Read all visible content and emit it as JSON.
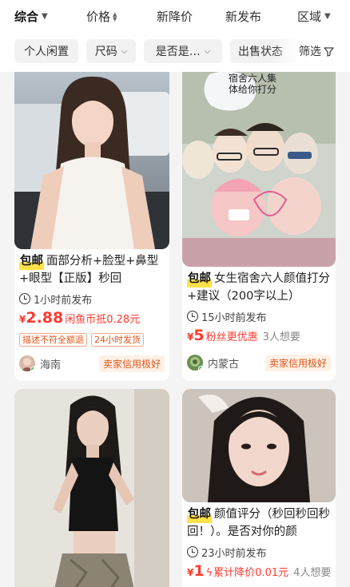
{
  "sort_bar": {
    "tabs": [
      {
        "label": "综合"
      },
      {
        "label": "价格"
      },
      {
        "label": "新降价"
      },
      {
        "label": "新发布"
      },
      {
        "label": "区域"
      }
    ]
  },
  "filter_bar": {
    "chips": [
      {
        "label": "个人闲置"
      },
      {
        "label": "尺码"
      },
      {
        "label": "是否是…"
      },
      {
        "label": "出售状态"
      }
    ],
    "filter_label": "筛选"
  },
  "listings": [
    {
      "badge": "包邮",
      "title": "面部分析+脸型+鼻型+眼型【正版】秒回",
      "time": "1小时前发布",
      "price_symbol": "¥",
      "price": "2.88",
      "price_note": "闲鱼币抵0.28元",
      "tags": [
        "描述不符全额退",
        "24小时发货"
      ],
      "location": "海南",
      "credit": "卖家信用极好"
    },
    {
      "badge": "包邮",
      "title": "女生宿舍六人颜值打分+建议（200字以上）",
      "time": "15小时前发布",
      "price_symbol": "¥",
      "price": "5",
      "price_note": "粉丝更优惠",
      "want": "3人想要",
      "image_caption": "宿舍六人集体给你打分",
      "location": "内蒙古",
      "credit": "卖家信用极好"
    },
    {
      "badge": "",
      "title": "",
      "time": "",
      "price": ""
    },
    {
      "badge": "包邮",
      "title": "颜值评分（秒回秒回秒回！）。是否对你的颜",
      "time": "23小时前发布",
      "price_symbol": "¥",
      "price": "1",
      "price_note": "累计降价0.01元",
      "want": "4人想要"
    }
  ],
  "colors": {
    "price_red": "#ff3b30",
    "baoyou_yellow": "#ffe24a",
    "credit_orange": "#e0561b",
    "online_green": "#2ec44b"
  }
}
